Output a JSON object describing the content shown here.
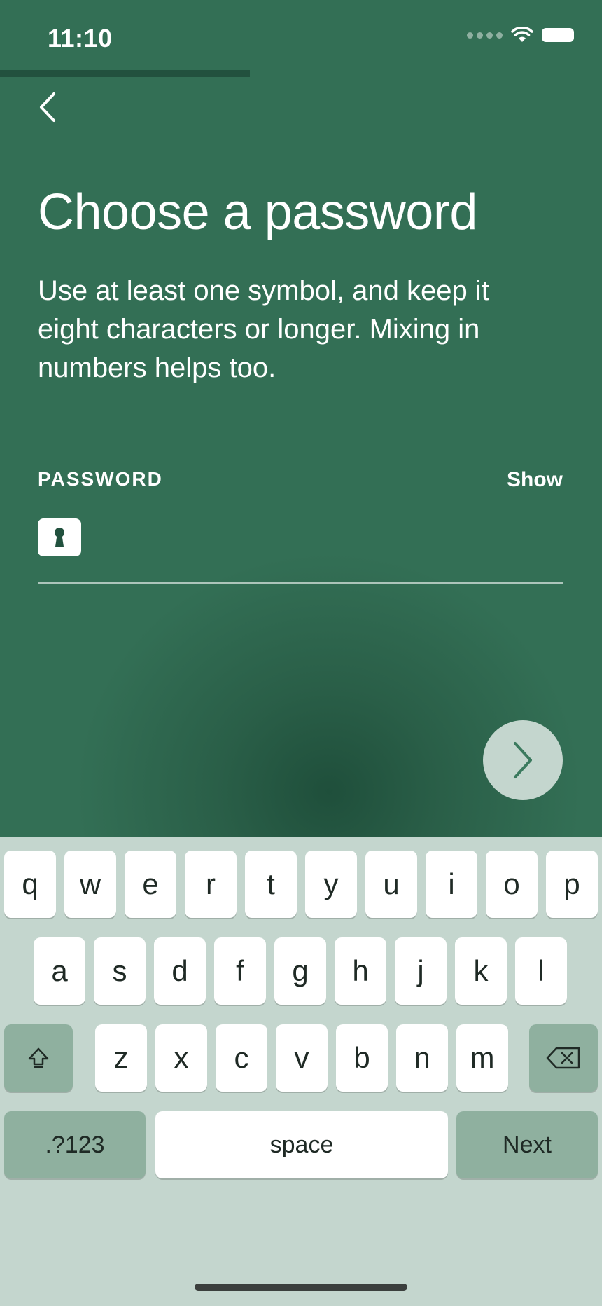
{
  "status_bar": {
    "time": "11:10"
  },
  "progress": {
    "value": 0.415
  },
  "header": {
    "back_icon": "chevron-left-icon"
  },
  "main": {
    "title": "Choose a password",
    "description": "Use at least one symbol, and keep it eight characters or longer. Mixing in numbers helps too.",
    "field": {
      "label": "PASSWORD",
      "show_label": "Show",
      "value": "",
      "icon": "keyhole-icon"
    },
    "next_icon": "chevron-right-icon"
  },
  "keyboard": {
    "row1": [
      "q",
      "w",
      "e",
      "r",
      "t",
      "y",
      "u",
      "i",
      "o",
      "p"
    ],
    "row2": [
      "a",
      "s",
      "d",
      "f",
      "g",
      "h",
      "j",
      "k",
      "l"
    ],
    "row3": [
      "z",
      "x",
      "c",
      "v",
      "b",
      "n",
      "m"
    ],
    "shift_icon": "shift-icon",
    "backspace_icon": "backspace-icon",
    "symbols_label": ".?123",
    "space_label": "space",
    "next_label": "Next"
  },
  "colors": {
    "background_green": "#336f55",
    "keyboard_bg": "#c4d6ce",
    "function_key": "#8fb09f",
    "progress_fill": "#22513e"
  }
}
